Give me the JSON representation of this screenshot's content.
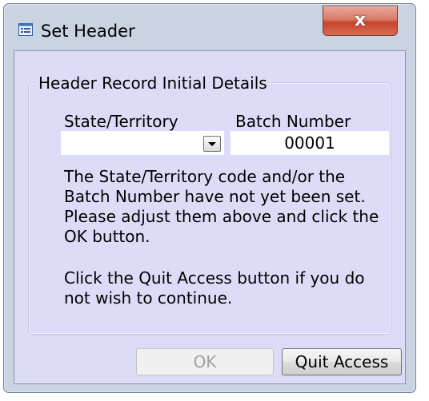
{
  "window": {
    "title": "Set Header",
    "close_glyph": "x",
    "icon": "form-icon"
  },
  "group": {
    "legend": "Header Record Initial Details"
  },
  "fields": {
    "state_label": "State/Territory",
    "state_value": "",
    "batch_label": "Batch Number",
    "batch_value": "00001"
  },
  "messages": {
    "line1": "The State/Territory code and/or the Batch Number have not yet been set. Please adjust them above and click the OK button.",
    "line2": "Click the Quit Access button if you do not wish to continue."
  },
  "buttons": {
    "ok_label": "OK",
    "ok_enabled": false,
    "quit_label": "Quit Access"
  },
  "colors": {
    "client_background": "#dcdcf8",
    "frame": "#c9d3e2",
    "close_button": "#c6442c"
  }
}
